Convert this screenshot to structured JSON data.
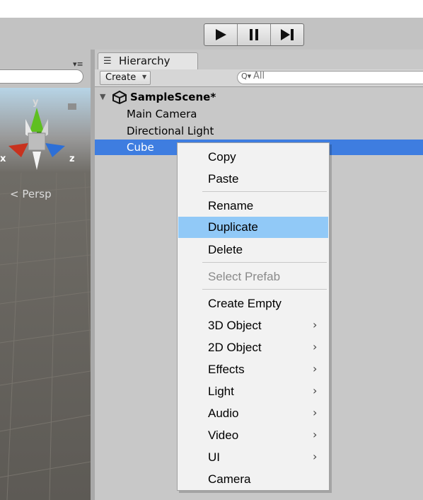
{
  "toolbar": {
    "play_icon": "play-icon",
    "pause_icon": "pause-icon",
    "step_icon": "step-icon"
  },
  "scene_view": {
    "projection_label": "Persp",
    "gizmo_axes": {
      "y": "y",
      "x": "x",
      "z": "z"
    },
    "menu_icon": "panel-menu-icon"
  },
  "hierarchy": {
    "tab_label": "Hierarchy",
    "create_label": "Create",
    "search_placeholder": "All",
    "scene_name": "SampleScene*",
    "items": [
      {
        "label": "Main Camera"
      },
      {
        "label": "Directional Light"
      },
      {
        "label": "Cube"
      }
    ]
  },
  "context_menu": {
    "items": [
      {
        "label": "Copy"
      },
      {
        "label": "Paste"
      },
      {
        "label": "Rename"
      },
      {
        "label": "Duplicate"
      },
      {
        "label": "Delete"
      },
      {
        "label": "Select Prefab"
      },
      {
        "label": "Create Empty"
      },
      {
        "label": "3D Object"
      },
      {
        "label": "2D Object"
      },
      {
        "label": "Effects"
      },
      {
        "label": "Light"
      },
      {
        "label": "Audio"
      },
      {
        "label": "Video"
      },
      {
        "label": "UI"
      },
      {
        "label": "Camera"
      }
    ],
    "highlighted": "Duplicate",
    "disabled": [
      "Select Prefab"
    ],
    "submenu_items": [
      "3D Object",
      "2D Object",
      "Effects",
      "Light",
      "Audio",
      "Video",
      "UI"
    ]
  },
  "colors": {
    "selection": "#3e7de0",
    "menu_highlight": "#91c9f7",
    "panel_bg": "#c8c8c8",
    "axis_y": "#5fbf20",
    "axis_x": "#c8321e",
    "axis_z": "#2d6fd6"
  }
}
